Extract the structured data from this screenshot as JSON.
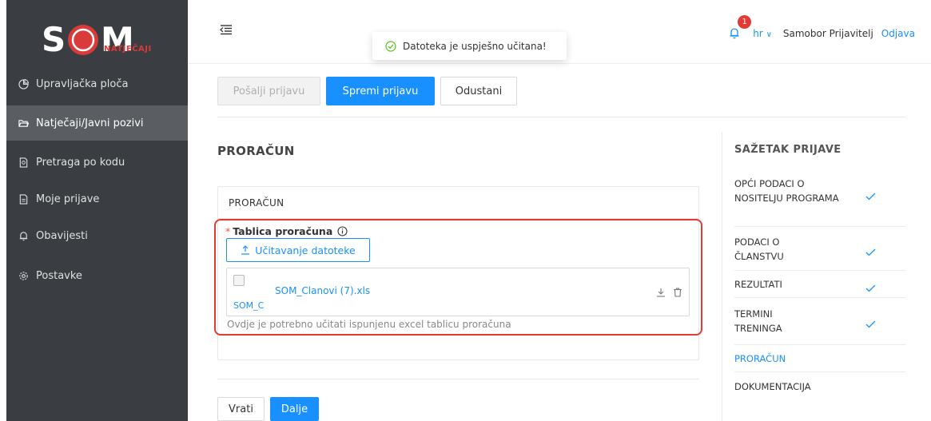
{
  "brand": {
    "logo_text": "SOM",
    "logo_sub": "NATJEČAJI"
  },
  "sidebar": {
    "items": [
      {
        "label": "Upravljačka ploča",
        "icon": "pie-chart-icon"
      },
      {
        "label": "Natječaji/Javni pozivi",
        "icon": "folder-open-icon"
      },
      {
        "label": "Pretraga po kodu",
        "icon": "file-search-icon"
      },
      {
        "label": "Moje prijave",
        "icon": "file-text-icon"
      },
      {
        "label": "Obavijesti",
        "icon": "bell-icon"
      },
      {
        "label": "Postavke",
        "icon": "gear-icon"
      }
    ],
    "active_index": 1
  },
  "header": {
    "notification_count": "1",
    "lang": "hr",
    "lang_chevron": "∨",
    "user": "Samobor Prijavitelj",
    "logout": "Odjava"
  },
  "toast": {
    "message": "Datoteka je uspješno učitana!"
  },
  "actions": {
    "submit": "Pošalji prijavu",
    "save": "Spremi prijavu",
    "cancel": "Odustani"
  },
  "main": {
    "section_title": "PRORAČUN",
    "card_title": "PRORAČUN",
    "field_required_mark": "*",
    "field_label": "Tablica proračuna",
    "upload_label": "Učitavanje datoteke",
    "file_name": "SOM_Clanovi (7).xls",
    "file_alt": "SOM_C",
    "help_text": "Ovdje je potrebno učitati ispunjenu excel tablicu proračuna"
  },
  "footer_nav": {
    "back": "Vrati",
    "next": "Dalje"
  },
  "summary": {
    "title": "SAŽETAK PRIJAVE",
    "items": [
      {
        "label": "OPĆI PODACI O NOSITELJU PROGRAMA",
        "done": true
      },
      {
        "label": "PODACI O ČLANSTVU",
        "done": true
      },
      {
        "label": "REZULTATI",
        "done": true
      },
      {
        "label": "TERMINI TRENINGA",
        "done": true
      },
      {
        "label": "PRORAČUN",
        "done": false,
        "active": true
      },
      {
        "label": "DOKUMENTACIJA",
        "done": false
      }
    ]
  },
  "colors": {
    "primary": "#1890ff",
    "sidebar": "#3a3d41",
    "sidebar_active": "#5a5d62",
    "alert": "#e53935"
  }
}
